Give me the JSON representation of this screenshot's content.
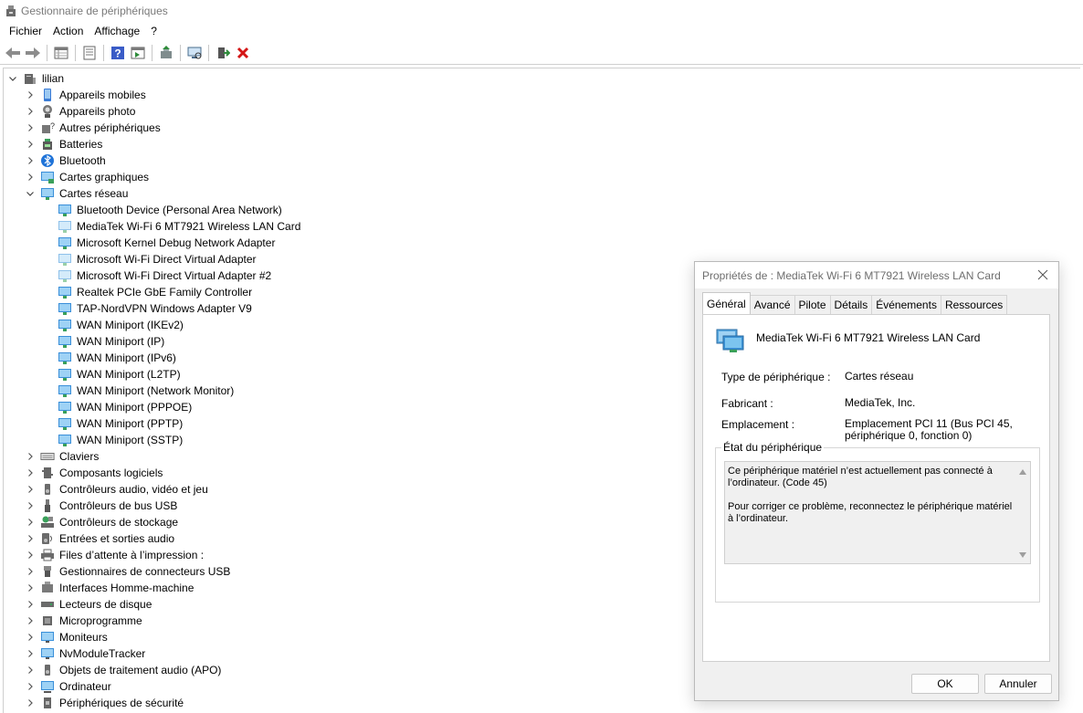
{
  "window": {
    "title": "Gestionnaire de périphériques"
  },
  "menu": [
    "Fichier",
    "Action",
    "Affichage",
    "?"
  ],
  "toolbar": {
    "icons": [
      "back-arrow-icon",
      "forward-arrow-icon",
      "properties-grid-icon",
      "show-hide-console-icon",
      "help-icon",
      "run-panel-icon",
      "update-driver-icon",
      "scan-hardware-icon",
      "enable-device-icon",
      "uninstall-icon"
    ]
  },
  "tree": {
    "root": "lilian",
    "categories": [
      {
        "label": "Appareils mobiles",
        "icon": "mobile-icon",
        "expanded": false
      },
      {
        "label": "Appareils photo",
        "icon": "camera-icon",
        "expanded": false
      },
      {
        "label": "Autres périphériques",
        "icon": "unknown-device-icon",
        "expanded": false
      },
      {
        "label": "Batteries",
        "icon": "battery-icon",
        "expanded": false
      },
      {
        "label": "Bluetooth",
        "icon": "bluetooth-icon",
        "expanded": false
      },
      {
        "label": "Cartes graphiques",
        "icon": "display-adapter-icon",
        "expanded": false
      },
      {
        "label": "Cartes réseau",
        "icon": "network-adapter-icon",
        "expanded": true,
        "children": [
          "Bluetooth Device (Personal Area Network)",
          "MediaTek Wi-Fi 6 MT7921 Wireless LAN Card",
          "Microsoft Kernel Debug Network Adapter",
          "Microsoft Wi-Fi Direct Virtual Adapter",
          "Microsoft Wi-Fi Direct Virtual Adapter #2",
          "Realtek PCIe GbE Family Controller",
          "TAP-NordVPN Windows Adapter V9",
          "WAN Miniport (IKEv2)",
          "WAN Miniport (IP)",
          "WAN Miniport (IPv6)",
          "WAN Miniport (L2TP)",
          "WAN Miniport (Network Monitor)",
          "WAN Miniport (PPPOE)",
          "WAN Miniport (PPTP)",
          "WAN Miniport (SSTP)"
        ]
      },
      {
        "label": "Claviers",
        "icon": "keyboard-icon",
        "expanded": false
      },
      {
        "label": "Composants logiciels",
        "icon": "software-component-icon",
        "expanded": false
      },
      {
        "label": "Contrôleurs audio, vidéo et jeu",
        "icon": "speaker-icon",
        "expanded": false
      },
      {
        "label": "Contrôleurs de bus USB",
        "icon": "usb-icon",
        "expanded": false
      },
      {
        "label": "Contrôleurs de stockage",
        "icon": "storage-controller-icon",
        "expanded": false
      },
      {
        "label": "Entrées et sorties audio",
        "icon": "audio-io-icon",
        "expanded": false
      },
      {
        "label": "Files d’attente à l’impression :",
        "icon": "printer-icon",
        "expanded": false
      },
      {
        "label": "Gestionnaires de connecteurs USB",
        "icon": "usb-connector-icon",
        "expanded": false
      },
      {
        "label": "Interfaces Homme-machine",
        "icon": "hid-icon",
        "expanded": false
      },
      {
        "label": "Lecteurs de disque",
        "icon": "disk-drive-icon",
        "expanded": false
      },
      {
        "label": "Microprogramme",
        "icon": "firmware-icon",
        "expanded": false
      },
      {
        "label": "Moniteurs",
        "icon": "monitor-icon",
        "expanded": false
      },
      {
        "label": "NvModuleTracker",
        "icon": "monitor-icon",
        "expanded": false
      },
      {
        "label": "Objets de traitement audio (APO)",
        "icon": "speaker-icon",
        "expanded": false
      },
      {
        "label": "Ordinateur",
        "icon": "computer-icon",
        "expanded": false
      },
      {
        "label": "Périphériques de sécurité",
        "icon": "security-device-icon",
        "expanded": false
      }
    ]
  },
  "dialog": {
    "title": "Propriétés de : MediaTek Wi-Fi 6 MT7921 Wireless LAN Card",
    "tabs": [
      "Général",
      "Avancé",
      "Pilote",
      "Détails",
      "Événements",
      "Ressources"
    ],
    "active_tab": "Général",
    "device_name": "MediaTek Wi-Fi 6 MT7921 Wireless LAN Card",
    "type_label": "Type de périphérique :",
    "type_value": "Cartes réseau",
    "manufacturer_label": "Fabricant :",
    "manufacturer_value": "MediaTek, Inc.",
    "location_label": "Emplacement :",
    "location_value_line1": "Emplacement PCI 11 (Bus PCI 45,",
    "location_value_line2": "périphérique 0, fonction 0)",
    "status_group_label": "État du périphérique",
    "status_line1": "Ce périphérique matériel n’est actuellement pas connecté à l’ordinateur.  (Code 45)",
    "status_line2": "Pour corriger ce problème, reconnectez le périphérique matériel à l’ordinateur.",
    "ok_label": "OK",
    "cancel_label": "Annuler"
  }
}
